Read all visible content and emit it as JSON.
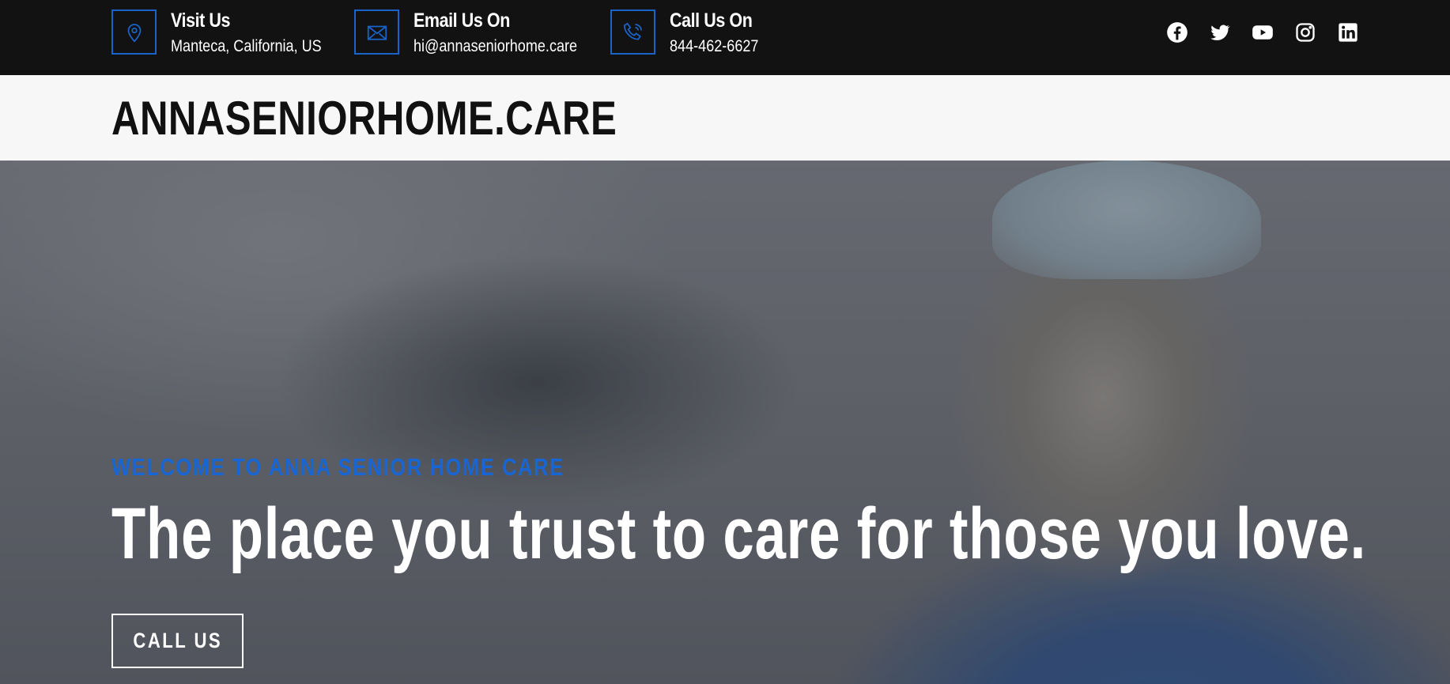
{
  "topbar": {
    "visit": {
      "title": "Visit Us",
      "value": "Manteca, California, US",
      "icon": "map-pin-icon"
    },
    "email": {
      "title": "Email Us On",
      "value": "hi@annaseniorhome.care",
      "icon": "envelope-icon"
    },
    "call": {
      "title": "Call Us On",
      "value": "844-462-6627",
      "icon": "phone-icon"
    },
    "social": [
      "facebook-icon",
      "twitter-icon",
      "youtube-icon",
      "instagram-icon",
      "linkedin-icon"
    ],
    "accent": "#1a63c9"
  },
  "header": {
    "logo": "ANNASENIORHOME.CARE"
  },
  "hero": {
    "kicker": "WELCOME TO ANNA SENIOR HOME CARE",
    "headline": "The place you trust to care for those you love.",
    "cta": "CALL US",
    "kicker_color": "#1766d4"
  }
}
